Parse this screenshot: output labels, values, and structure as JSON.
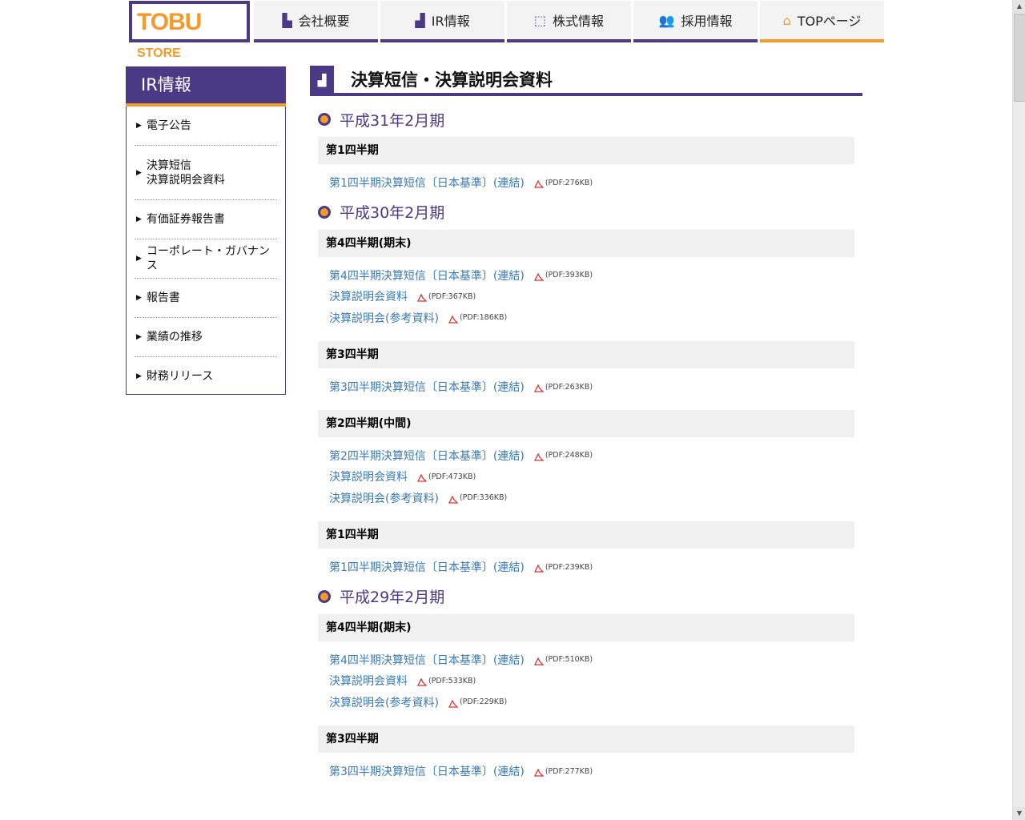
{
  "logo": {
    "text": "TOBU",
    "store": "STORE"
  },
  "nav": [
    {
      "label": "会社概要",
      "icon": "building-icon",
      "glyph": "▙"
    },
    {
      "label": "IR情報",
      "icon": "bar-chart-icon",
      "glyph": "▟"
    },
    {
      "label": "株式情報",
      "icon": "line-chart-icon",
      "glyph": "⬚"
    },
    {
      "label": "採用情報",
      "icon": "people-icon",
      "glyph": "👥"
    },
    {
      "label": "TOPページ",
      "icon": "store-icon",
      "glyph": "⌂"
    }
  ],
  "sidebar": {
    "title": "IR情報",
    "items": [
      {
        "label": "電子公告"
      },
      {
        "label": "決算短信",
        "label2": "決算説明会資料"
      },
      {
        "label": "有価証券報告書"
      },
      {
        "label": "コーポレート・ガバナンス"
      },
      {
        "label": "報告書"
      },
      {
        "label": "業績の推移"
      },
      {
        "label": "財務リリース"
      }
    ]
  },
  "page": {
    "title": "決算短信・決算説明会資料"
  },
  "sections": [
    {
      "year": "平成31年2月期",
      "quarters": [
        {
          "title": "第1四半期",
          "links": [
            {
              "text": "第1四半期決算短信〔日本基準〕(連結)",
              "size": "(PDF:276KB)"
            }
          ]
        }
      ]
    },
    {
      "year": "平成30年2月期",
      "quarters": [
        {
          "title": "第4四半期(期末)",
          "links": [
            {
              "text": "第4四半期決算短信〔日本基準〕(連結)",
              "size": "(PDF:393KB)"
            },
            {
              "text": "決算説明会資料",
              "size": "(PDF:367KB)"
            },
            {
              "text": "決算説明会(参考資料)",
              "size": "(PDF:186KB)"
            }
          ]
        },
        {
          "title": "第3四半期",
          "links": [
            {
              "text": "第3四半期決算短信〔日本基準〕(連結)",
              "size": "(PDF:263KB)"
            }
          ]
        },
        {
          "title": "第2四半期(中間)",
          "links": [
            {
              "text": "第2四半期決算短信〔日本基準〕(連結)",
              "size": "(PDF:248KB)"
            },
            {
              "text": "決算説明会資料",
              "size": "(PDF:473KB)"
            },
            {
              "text": "決算説明会(参考資料)",
              "size": "(PDF:336KB)"
            }
          ]
        },
        {
          "title": "第1四半期",
          "links": [
            {
              "text": "第1四半期決算短信〔日本基準〕(連結)",
              "size": "(PDF:239KB)"
            }
          ]
        }
      ]
    },
    {
      "year": "平成29年2月期",
      "quarters": [
        {
          "title": "第4四半期(期末)",
          "links": [
            {
              "text": "第4四半期決算短信〔日本基準〕(連結)",
              "size": "(PDF:510KB)"
            },
            {
              "text": "決算説明会資料",
              "size": "(PDF:533KB)"
            },
            {
              "text": "決算説明会(参考資料)",
              "size": "(PDF:229KB)"
            }
          ]
        },
        {
          "title": "第3四半期",
          "links": [
            {
              "text": "第3四半期決算短信〔日本基準〕(連結)",
              "size": "(PDF:277KB)"
            }
          ]
        }
      ]
    }
  ],
  "colors": {
    "brand_purple": "#4a3a86",
    "accent_orange": "#f39a2a",
    "link_blue": "#3a7ab5"
  }
}
